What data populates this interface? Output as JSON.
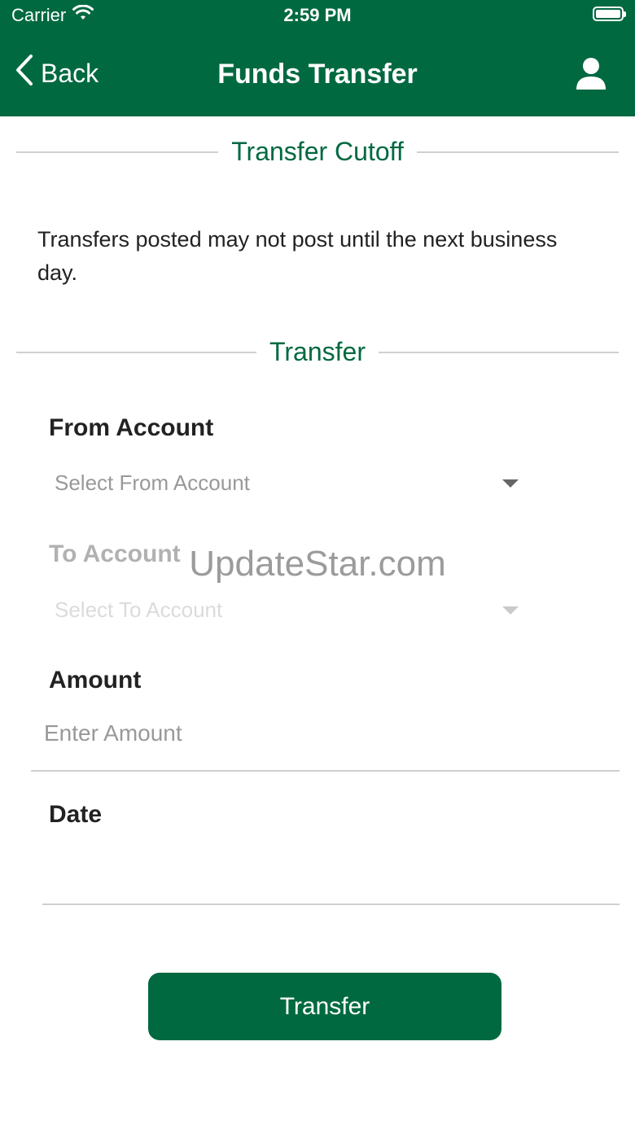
{
  "status_bar": {
    "carrier": "Carrier",
    "time": "2:59 PM"
  },
  "nav": {
    "back_label": "Back",
    "title": "Funds Transfer"
  },
  "cutoff_section": {
    "title": "Transfer Cutoff",
    "message": "Transfers posted may not post until the next business day."
  },
  "transfer_section": {
    "title": "Transfer",
    "from_account": {
      "label": "From Account",
      "placeholder": "Select From Account"
    },
    "to_account": {
      "label": "To Account",
      "placeholder": "Select To Account"
    },
    "amount": {
      "label": "Amount",
      "placeholder": "Enter Amount"
    },
    "date": {
      "label": "Date",
      "value": ""
    },
    "submit_label": "Transfer"
  },
  "watermark": "UpdateStar.com",
  "colors": {
    "brand_green": "#006940",
    "divider": "#d0d0d0",
    "placeholder": "#999999"
  },
  "icons": [
    "wifi-icon",
    "battery-icon",
    "chevron-left-icon",
    "user-icon",
    "caret-down-icon"
  ]
}
